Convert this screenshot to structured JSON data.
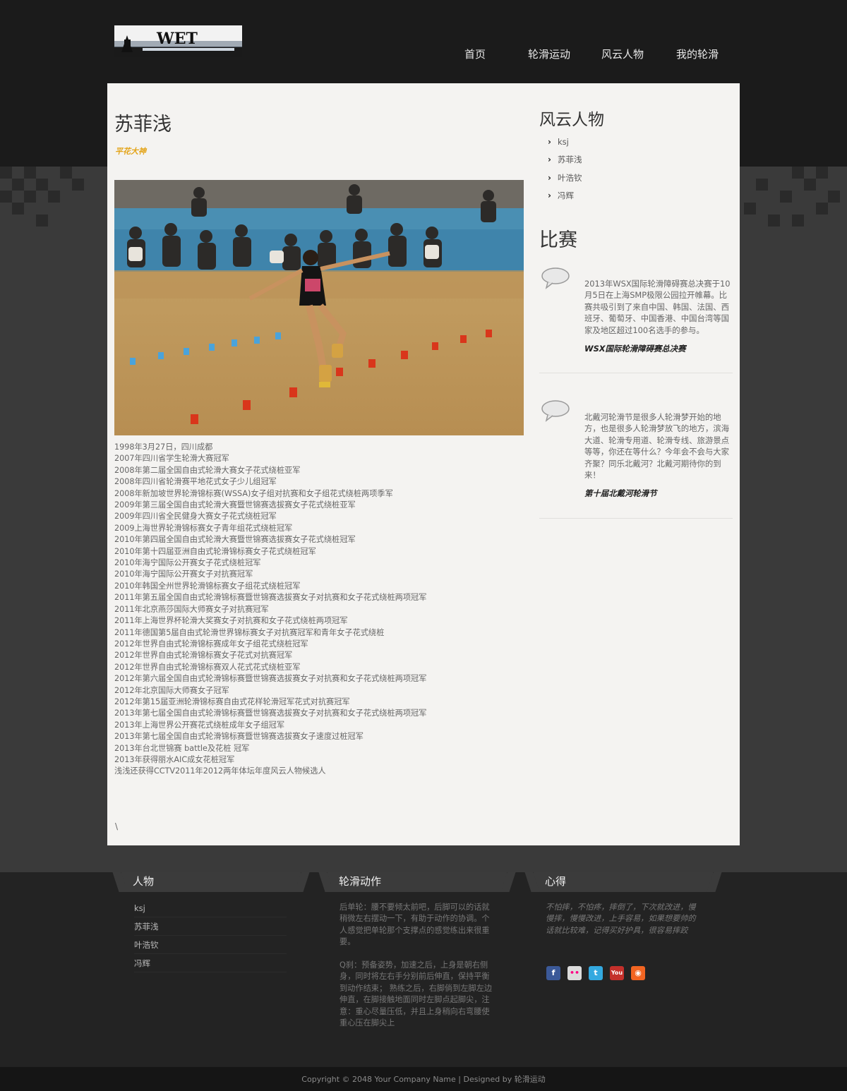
{
  "header": {
    "logo_alt": "WET logo",
    "nav": [
      "首页",
      "轮滑运动",
      "风云人物",
      "我的轮滑"
    ]
  },
  "main": {
    "title": "苏菲浅",
    "subtitle": "平花大神",
    "bio_lines": [
      "1998年3月27日，四川成都",
      "2007年四川省学生轮滑大赛冠军",
      "2008年第二届全国自由式轮滑大赛女子花式绕桩亚军",
      "2008年四川省轮滑赛平地花式女子少儿组冠军",
      "2008年新加坡世界轮滑锦标赛(WSSA)女子组对抗赛和女子组花式绕桩两项季军",
      "2009年第三届全国自由式轮滑大赛暨世锦赛选拔赛女子花式绕桩亚军",
      "2009年四川省全民健身大赛女子花式绕桩冠军",
      "2009上海世界轮滑锦标赛女子青年组花式绕桩冠军",
      "2010年第四届全国自由式轮滑大赛暨世锦赛选拔赛女子花式绕桩冠军",
      "2010年第十四届亚洲自由式轮滑锦标赛女子花式绕桩冠军",
      "2010年海宁国际公开赛女子花式绕桩冠军",
      "2010年海宁国际公开赛女子对抗赛冠军",
      "2010年韩国全州世界轮滑锦标赛女子组花式绕桩冠军",
      "2011年第五届全国自由式轮滑锦标赛暨世锦赛选拔赛女子对抗赛和女子花式绕桩两项冠军",
      "2011年北京燕莎国际大师赛女子对抗赛冠军",
      "2011年上海世界杯轮滑大奖赛女子对抗赛和女子花式绕桩两项冠军",
      "2011年德国第5届自由式轮滑世界锦标赛女子对抗赛冠军和青年女子花式绕桩",
      "2012年世界自由式轮滑锦标赛成年女子组花式绕桩冠军",
      "2012年世界自由式轮滑锦标赛女子花式对抗赛冠军",
      "2012年世界自由式轮滑锦标赛双人花式花式绕桩亚军",
      "2012年第六届全国自由式轮滑锦标赛暨世锦赛选拔赛女子对抗赛和女子花式绕桩两项冠军",
      "2012年北京国际大师赛女子冠军",
      "2012年第15届亚洲轮滑锦标赛自由式花样轮滑冠军花式对抗赛冠军",
      "2013年第七届全国自由式轮滑锦标赛暨世锦赛选拔赛女子对抗赛和女子花式绕桩两项冠军",
      "2013年上海世界公开赛花式绕桩成年女子组冠军",
      "2013年第七届全国自由式轮滑锦标赛暨世锦赛选拔赛女子速度过桩冠军",
      "2013年台北世锦赛 battle及花桩 冠军",
      "2013年获得丽水AIC成女花桩冠军",
      "浅浅还获得CCTV2011年2012两年体坛年度风云人物候选人"
    ],
    "trailing_char": "\\"
  },
  "sidebar": {
    "people_title": "风云人物",
    "people": [
      "ksj",
      "苏菲浅",
      "叶浩钦",
      "冯辉"
    ],
    "events_title": "比赛",
    "events": [
      {
        "text": "2013年WSX国际轮滑障碍赛总决赛于10月5日在上海SMP极限公园拉开帷幕。比赛共吸引到了来自中国、韩国、法国、西班牙、葡萄牙、中国香港、中国台湾等国家及地区超过100名选手的参与。",
        "link": "WSX国际轮滑障碍赛总决赛"
      },
      {
        "text": "北戴河轮滑节是很多人轮滑梦开始的地方，也是很多人轮滑梦放飞的地方，滨海大道、轮滑专用道、轮滑专线、旅游景点等等，你还在等什么？今年会不会与大家齐聚？同乐北戴河？北戴河期待你的到来！",
        "link": "第十届北戴河轮滑节"
      }
    ]
  },
  "footer": {
    "col1": {
      "title": "人物",
      "items": [
        "ksj",
        "苏菲浅",
        "叶浩钦",
        "冯辉"
      ]
    },
    "col2": {
      "title": "轮滑动作",
      "p1": "后单轮：腰不要倾太前吧，后脚可以的话就稍微左右摆动一下，有助于动作的协调。个人感觉把单轮那个支撑点的感觉练出来很重要。",
      "p2": "Q刹：预备姿势，加速之后，上身是朝右侧身，同时将左右手分别前后伸直，保持平衡到动作结束； 熟练之后，右脚倘到左脚左边伸直，在脚接触地面同时左脚点起脚尖，注意：重心尽量压低，并且上身稍向右弯腰使重心压在脚尖上"
    },
    "col3": {
      "title": "心得",
      "text": "不怕摔，不怕疼，摔倒了，下次就改进，慢慢摔，慢慢改进，上手容易，如果想要帅的话就比较难，记得买好护具，很容易摔跤",
      "social_icons": [
        "facebook-icon",
        "flickr-icon",
        "twitter-icon",
        "youtube-icon",
        "rss-icon"
      ]
    },
    "copyright": "Copyright © 2048 Your Company Name | Designed by 轮滑运动"
  },
  "colors": {
    "accent_subtitle": "#e3a316",
    "panel_bg": "#f4f3f1",
    "page_bg": "#1b1b1b"
  }
}
